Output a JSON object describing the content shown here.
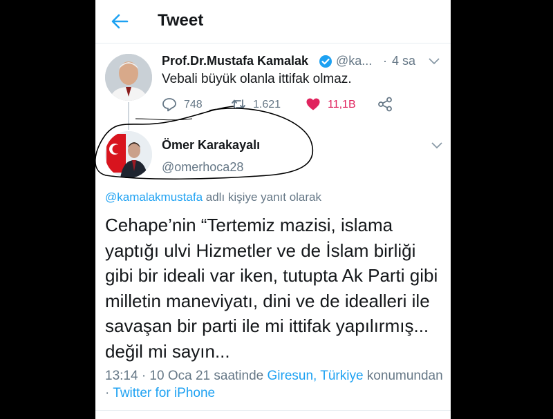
{
  "header": {
    "title": "Tweet",
    "back_icon": "arrow-left-icon",
    "accent": "#1da1f2"
  },
  "parent_tweet": {
    "name": "Prof.Dr.Mustafa Kamalak",
    "handle": "@ka...",
    "dot": "·",
    "time": "4 sa",
    "text": "Vebali büyük olanla ittifak olmaz.",
    "replies": "748",
    "retweets": "1.621",
    "likes": "11,1B",
    "like_color": "#e0245e"
  },
  "main_tweet": {
    "name": "Ömer Karakayalı",
    "handle": "@omerhoca28",
    "reply_to_handle": "@kamalakmustafa",
    "reply_to_suffix": " adlı kişiye yanıt olarak",
    "text": "Cehape’nin “Tertemiz mazisi, islama yaptığı ulvi Hizmetler ve de İslam birliği gibi bir ideali var iken, tutupta Ak Parti gibi milletin maneviyatı, dini ve de idealleri ile savaşan bir parti ile mi ittifak yapılırmış... değil mi sayın...",
    "meta_time": "13:14 · 10 Oca 21 saatinde ",
    "meta_location": "Giresun, Türkiye",
    "meta_suffix": " konumundan · ",
    "meta_source": "Twitter for iPhone"
  }
}
